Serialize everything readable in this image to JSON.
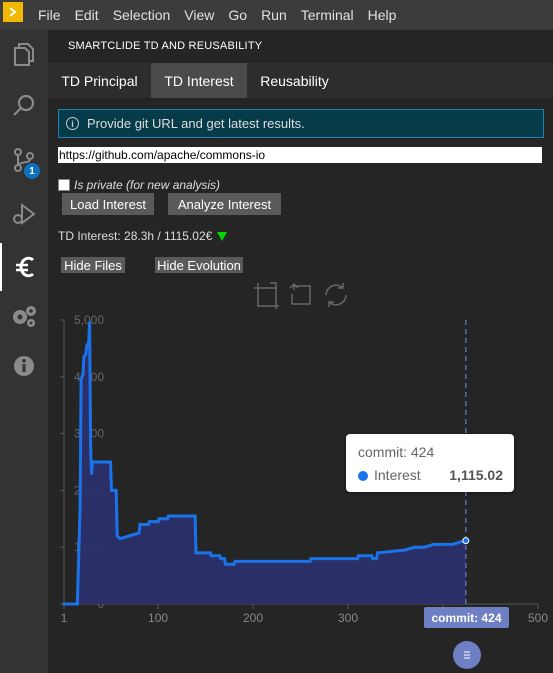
{
  "menubar": {
    "logo_icon": "vscode-logo-icon",
    "items": [
      "File",
      "Edit",
      "Selection",
      "View",
      "Go",
      "Run",
      "Terminal",
      "Help"
    ]
  },
  "activity": {
    "icons": [
      "files-icon",
      "search-icon",
      "source-control-icon",
      "run-debug-icon",
      "euro-icon",
      "settings-gears-icon",
      "info-icon"
    ],
    "source_control_badge": "1"
  },
  "panel": {
    "title": "SMARTCLIDE TD AND REUSABILITY",
    "tabs": [
      "TD Principal",
      "TD Interest",
      "Reusability"
    ],
    "active_tab": "TD Interest",
    "info_message": "Provide git URL and get latest results.",
    "git_url": "https://github.com/apache/commons-io",
    "private_label": "Is private (for new analysis)",
    "load_button": "Load Interest",
    "analyze_button": "Analyze Interest",
    "td_interest_text": "TD Interest: 28.3h / 1115.02€",
    "trend": "down",
    "hide_files_button": "Hide Files",
    "hide_evolution_button": "Hide Evolution"
  },
  "toolbox": {
    "icons": [
      "zoom-select-icon",
      "zoom-reset-icon",
      "restore-icon"
    ]
  },
  "tooltip": {
    "title": "commit: 424",
    "series": "Interest",
    "value": "1,115.02"
  },
  "axis_pointer_label": "commit: 424",
  "chart_data": {
    "type": "area",
    "x_label": "",
    "y_label": "",
    "xlim": [
      1,
      500
    ],
    "ylim": [
      0,
      5000
    ],
    "x_ticks": [
      "1",
      "100",
      "200",
      "300",
      "400",
      "500"
    ],
    "y_ticks": [
      "0",
      "1,000",
      "2,000",
      "3,000",
      "4,000",
      "5,000"
    ],
    "grid": false,
    "series": [
      {
        "name": "Interest",
        "color": "#1a73e8",
        "fill": "#2b2f6b",
        "points": [
          [
            1,
            0
          ],
          [
            15,
            0
          ],
          [
            18,
            1700
          ],
          [
            19,
            3950
          ],
          [
            21,
            4050
          ],
          [
            22,
            4350
          ],
          [
            24,
            4400
          ],
          [
            25,
            4550
          ],
          [
            27,
            4600
          ],
          [
            28,
            4950
          ],
          [
            29,
            2800
          ],
          [
            30,
            2300
          ],
          [
            31,
            2500
          ],
          [
            35,
            2500
          ],
          [
            50,
            2500
          ],
          [
            51,
            2000
          ],
          [
            56,
            2000
          ],
          [
            57,
            1200
          ],
          [
            60,
            1150
          ],
          [
            70,
            1200
          ],
          [
            80,
            1250
          ],
          [
            81,
            1400
          ],
          [
            90,
            1400
          ],
          [
            91,
            1450
          ],
          [
            100,
            1450
          ],
          [
            101,
            1500
          ],
          [
            110,
            1500
          ],
          [
            111,
            1550
          ],
          [
            121,
            1550
          ],
          [
            139,
            1550
          ],
          [
            140,
            900
          ],
          [
            155,
            900
          ],
          [
            156,
            850
          ],
          [
            165,
            850
          ],
          [
            166,
            800
          ],
          [
            170,
            800
          ],
          [
            171,
            700
          ],
          [
            180,
            700
          ],
          [
            181,
            750
          ],
          [
            260,
            750
          ],
          [
            261,
            800
          ],
          [
            310,
            800
          ],
          [
            311,
            850
          ],
          [
            325,
            850
          ],
          [
            326,
            800
          ],
          [
            330,
            800
          ],
          [
            331,
            900
          ],
          [
            360,
            950
          ],
          [
            370,
            1000
          ],
          [
            380,
            1000
          ],
          [
            390,
            1050
          ],
          [
            410,
            1050
          ],
          [
            420,
            1100
          ],
          [
            424,
            1115.02
          ]
        ]
      }
    ],
    "highlight": {
      "x": 424,
      "y": 1115.02
    }
  }
}
